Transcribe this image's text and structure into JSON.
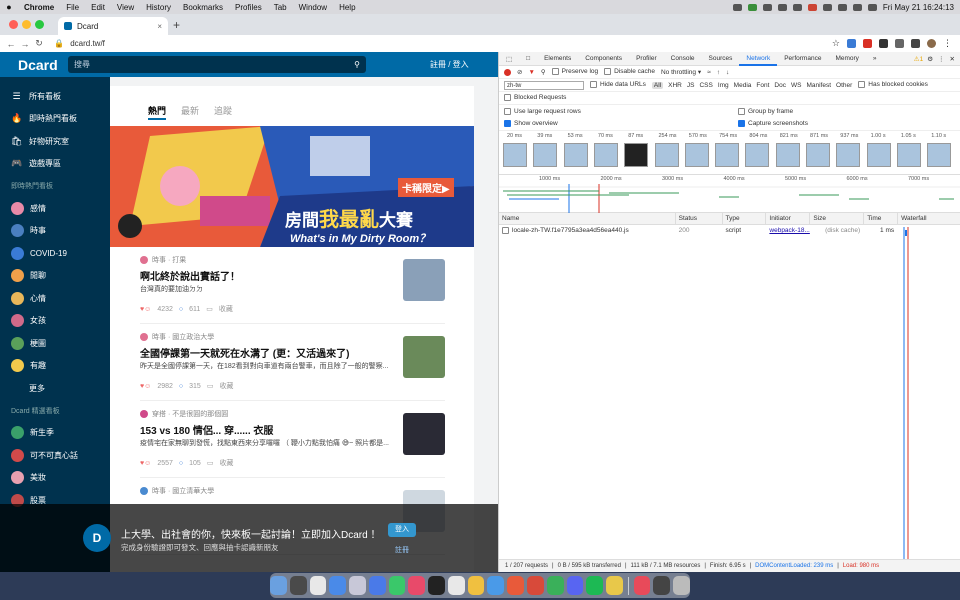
{
  "menubar": {
    "apple": "",
    "app": "Chrome",
    "items": [
      "File",
      "Edit",
      "View",
      "History",
      "Bookmarks",
      "Profiles",
      "Tab",
      "Window",
      "Help"
    ],
    "clock": "Fri May 21  16:24:13"
  },
  "chrome": {
    "tab_title": "Dcard",
    "tab_close": "×",
    "new_tab": "+",
    "url": "dcard.tw/f"
  },
  "dcard": {
    "logo": "Dcard",
    "search_placeholder": "搜尋",
    "login_label": "註冊 / 登入",
    "sidebar_main": [
      {
        "label": "所有看板",
        "icon": "☰"
      },
      {
        "label": "即時熱門看板",
        "icon": "🔥"
      },
      {
        "label": "好物研究室",
        "icon": "🛍"
      },
      {
        "label": "遊戲專區",
        "icon": "🎮"
      }
    ],
    "section_hot": "即時熱門看板",
    "hot_boards": [
      {
        "label": "感情",
        "color": "#e88aa8"
      },
      {
        "label": "時事",
        "color": "#4a7fc0"
      },
      {
        "label": "COVID-19",
        "color": "#3a7bd5"
      },
      {
        "label": "閒聊",
        "color": "#f0a04a"
      },
      {
        "label": "心情",
        "color": "#e8b75a"
      },
      {
        "label": "女孩",
        "color": "#d06a8a"
      },
      {
        "label": "梗圖",
        "color": "#5aa05a"
      },
      {
        "label": "有趣",
        "color": "#f2c94c"
      }
    ],
    "more_label": "更多",
    "section_picked": "Dcard 精選看板",
    "picked_boards": [
      {
        "label": "新生季",
        "color": "#3aa06a"
      },
      {
        "label": "可不可真心話",
        "color": "#d04a4a"
      },
      {
        "label": "美妝",
        "color": "#e8a0b0"
      },
      {
        "label": "股票",
        "color": "#c04a4a"
      }
    ],
    "feed_tabs": [
      "熱門",
      "最新",
      "追蹤"
    ],
    "banner": {
      "tag": "卡稱限定▶",
      "title_part1": "房間",
      "title_part2": "我最亂",
      "title_part3": "大賽",
      "subtitle": "What's in My Dirty Room？"
    },
    "posts": [
      {
        "meta": "時事 · 打果",
        "meta_color": "#e07090",
        "title": "啊北終於說出實話了！",
        "excerpt": "台灣真的要加油ㄉㄉ",
        "reactions": "4232",
        "comments": "611",
        "save": "收藏",
        "thumb": "#8aa0b8"
      },
      {
        "meta": "時事 · 國立政治大學",
        "meta_color": "#e07090",
        "title": "全國停課第一天就死在水溝了 (更：又活過來了)",
        "excerpt": "昨天是全國停課第一天，在182看到對向車道有兩台警車，而且除了一般的警察...",
        "reactions": "2982",
        "comments": "315",
        "save": "收藏",
        "thumb": "#6a8a5a"
      },
      {
        "meta": "穿搭 · 不是很圓的那個圓",
        "meta_color": "#d04a8a",
        "title": "153 vs 180 情侶... 穿...... 衣服",
        "excerpt": "疫情宅在家無聊到發慌，找點東西來分享囉囉 （ 鞭小力點我怕痛 😅~ 照片都是...",
        "reactions": "2557",
        "comments": "105",
        "save": "收藏",
        "thumb": "#2a2a35"
      },
      {
        "meta": "時事 · 國立清華大學",
        "meta_color": "#4a8ad0",
        "title": "",
        "excerpt": "",
        "reactions": "",
        "comments": "",
        "save": "",
        "thumb": "#cfd8e0"
      }
    ],
    "promo": {
      "title": "上大學、出社會的你，快來板一起討論！立即加入Dcard ！",
      "subtitle": "完成身份驗證即可發文、回應與抽卡認識新朋友",
      "login": "登入",
      "register": "註冊"
    }
  },
  "devtools": {
    "tabs": [
      "Elements",
      "Components",
      "Profiler",
      "Console",
      "Sources",
      "Network",
      "Performance",
      "Memory"
    ],
    "active_tab": "Network",
    "more": "»",
    "warning": "⚠1",
    "toolbar": {
      "preserve_log": "Preserve log",
      "disable_cache": "Disable cache",
      "throttle": "No throttling"
    },
    "filter": {
      "value": "zh-tw",
      "hide_data": "Hide data URLs",
      "types": [
        "All",
        "XHR",
        "JS",
        "CSS",
        "Img",
        "Media",
        "Font",
        "Doc",
        "WS",
        "Manifest",
        "Other"
      ],
      "blocked_cookies": "Has blocked cookies"
    },
    "options": {
      "blocked": "Blocked Requests",
      "large_rows": "Use large request rows",
      "group_frame": "Group by frame",
      "overview": "Show overview",
      "screenshots": "Capture screenshots"
    },
    "shot_times": [
      "20 ms",
      "39 ms",
      "53 ms",
      "70 ms",
      "87 ms",
      "254 ms",
      "570 ms",
      "754 ms",
      "804 ms",
      "821 ms",
      "871 ms",
      "937 ms",
      "1.00 s",
      "1.05 s",
      "1.10 s"
    ],
    "overview_ticks": [
      "1000 ms",
      "2000 ms",
      "3000 ms",
      "4000 ms",
      "5000 ms",
      "6000 ms",
      "7000 ms"
    ],
    "columns": [
      "Name",
      "Status",
      "Type",
      "Initiator",
      "Size",
      "Time",
      "Waterfall"
    ],
    "row": {
      "name": "locale-zh-TW.f1e7795a3ea4d56ea440.js",
      "status": "200",
      "type": "script",
      "initiator": "webpack-18...",
      "size": "(disk cache)",
      "time": "1 ms"
    },
    "status": {
      "requests": "1 / 207 requests",
      "transferred": "0 B / 595 kB transferred",
      "resources": "111 kB / 7.1 MB resources",
      "finish": "Finish: 6.95 s",
      "dcl": "DOMContentLoaded: 239 ms",
      "load": "Load: 980 ms"
    }
  },
  "dock_colors": [
    "#6aa0e0",
    "#4a4a4a",
    "#e8e8e8",
    "#4a8ae8",
    "#c8c8d8",
    "#4a7ae8",
    "#3ac86a",
    "#e84a6a",
    "#222",
    "#e8e8e8",
    "#f0c040",
    "#4a9ae8",
    "#e85a3a",
    "#d84a3a",
    "#3ab05a",
    "#5865f2",
    "#1db954",
    "#e8c84a",
    "#e84a5a",
    "#444",
    "#bbb"
  ]
}
